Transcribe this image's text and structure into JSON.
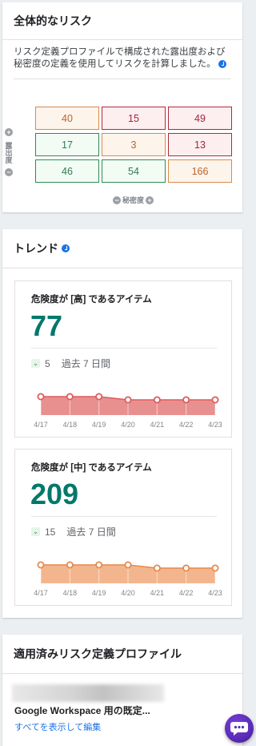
{
  "risk_card": {
    "title": "全体的なリスク",
    "description": "リスク定義プロファイルで構成された露出度および秘密度の定義を使用してリスクを計算しました。",
    "y_axis_label": "露出度",
    "x_axis_label": "秘密度",
    "plus_glyph": "+",
    "minus_glyph": "−",
    "matrix": [
      [
        {
          "value": "40",
          "level": "med"
        },
        {
          "value": "15",
          "level": "high"
        },
        {
          "value": "49",
          "level": "high"
        }
      ],
      [
        {
          "value": "17",
          "level": "low"
        },
        {
          "value": "3",
          "level": "med"
        },
        {
          "value": "13",
          "level": "high"
        }
      ],
      [
        {
          "value": "46",
          "level": "low"
        },
        {
          "value": "54",
          "level": "low"
        },
        {
          "value": "166",
          "level": "med"
        }
      ]
    ]
  },
  "trend_card": {
    "title": "トレンド",
    "dates": [
      "4/17",
      "4/18",
      "4/19",
      "4/20",
      "4/21",
      "4/22",
      "4/23"
    ],
    "items": [
      {
        "title": "危険度が [高] であるアイテム",
        "count": "77",
        "delta": "5",
        "period": "過去 7 日間",
        "color": "#e05a5a",
        "fill": "#e89090",
        "values": [
          77,
          77,
          77,
          76,
          76,
          76,
          76
        ]
      },
      {
        "title": "危険度が [中] であるアイテム",
        "count": "209",
        "delta": "15",
        "period": "過去 7 日間",
        "color": "#e8884a",
        "fill": "#f3b58e",
        "values": [
          209,
          209,
          209,
          209,
          208,
          208,
          208
        ]
      }
    ]
  },
  "profile_card": {
    "title": "適用済みリスク定義プロファイル",
    "profile_name": "Google Workspace 用の既定...",
    "view_link": "すべてを表示して編集"
  },
  "icons": {
    "info": "info-icon",
    "chevron": "chevron-down-icon",
    "chat": "chat-icon"
  }
}
